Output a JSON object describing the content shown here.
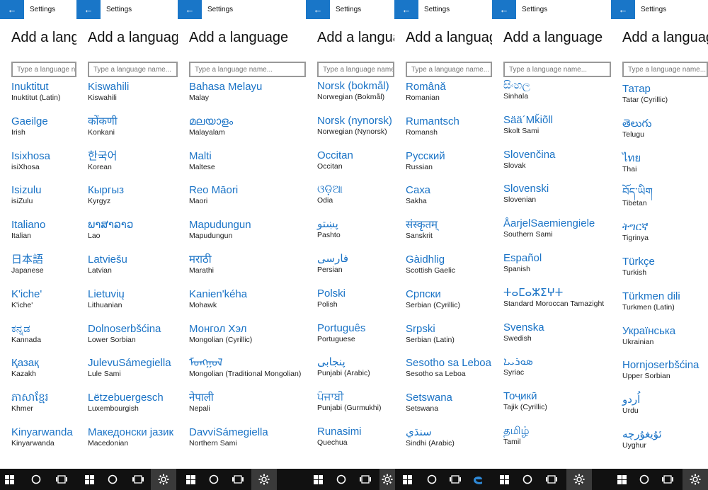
{
  "window": {
    "title": "Settings",
    "back": "←"
  },
  "page": {
    "title": "Add a language",
    "search_placeholder": "Type a language name..."
  },
  "columns": [
    {
      "languages": [
        {
          "native": "Inuktitut",
          "english": "Inuktitut (Latin)"
        },
        {
          "native": "Gaeilge",
          "english": "Irish"
        },
        {
          "native": "Isixhosa",
          "english": "isiXhosa"
        },
        {
          "native": "Isizulu",
          "english": "isiZulu"
        },
        {
          "native": "Italiano",
          "english": "Italian"
        },
        {
          "native": "日本語",
          "english": "Japanese"
        },
        {
          "native": "K'iche'",
          "english": "K'iche'"
        },
        {
          "native": "ಕನ್ನಡ",
          "english": "Kannada"
        },
        {
          "native": "Қазақ",
          "english": "Kazakh"
        },
        {
          "native": "ភាសាខ្មែរ",
          "english": "Khmer"
        },
        {
          "native": "Kinyarwanda",
          "english": "Kinyarwanda"
        }
      ]
    },
    {
      "languages": [
        {
          "native": "Kiswahili",
          "english": "Kiswahili"
        },
        {
          "native": "कोंकणी",
          "english": "Konkani"
        },
        {
          "native": "한국어",
          "english": "Korean"
        },
        {
          "native": "Кыргыз",
          "english": "Kyrgyz"
        },
        {
          "native": "ພາສາລາວ",
          "english": "Lao"
        },
        {
          "native": "Latviešu",
          "english": "Latvian"
        },
        {
          "native": "Lietuvių",
          "english": "Lithuanian"
        },
        {
          "native": "Dolnoserbšćina",
          "english": "Lower Sorbian"
        },
        {
          "native": "JulevuSámegiella",
          "english": "Lule Sami"
        },
        {
          "native": "Lëtzebuergesch",
          "english": "Luxembourgish"
        },
        {
          "native": "Македонски јазик",
          "english": "Macedonian"
        }
      ]
    },
    {
      "languages": [
        {
          "native": "Bahasa Melayu",
          "english": "Malay"
        },
        {
          "native": "മലയാളം",
          "english": "Malayalam"
        },
        {
          "native": "Malti",
          "english": "Maltese"
        },
        {
          "native": "Reo Māori",
          "english": "Maori"
        },
        {
          "native": "Mapudungun",
          "english": "Mapudungun"
        },
        {
          "native": "मराठी",
          "english": "Marathi"
        },
        {
          "native": "Kanien'kéha",
          "english": "Mohawk"
        },
        {
          "native": "Монгол Хэл",
          "english": "Mongolian (Cyrillic)"
        },
        {
          "native": "ᠮᠣᠩᠭᠣᠯ",
          "english": "Mongolian (Traditional Mongolian)"
        },
        {
          "native": "नेपाली",
          "english": "Nepali"
        },
        {
          "native": "DavviSámegiella",
          "english": "Northern Sami"
        }
      ]
    },
    {
      "languages": [
        {
          "native": "Norsk (bokmål)",
          "english": "Norwegian (Bokmål)"
        },
        {
          "native": "Norsk (nynorsk)",
          "english": "Norwegian (Nynorsk)"
        },
        {
          "native": "Occitan",
          "english": "Occitan"
        },
        {
          "native": "ଓଡ଼ିଆ",
          "english": "Odia"
        },
        {
          "native": "پښتو",
          "english": "Pashto"
        },
        {
          "native": "فارسی",
          "english": "Persian"
        },
        {
          "native": "Polski",
          "english": "Polish"
        },
        {
          "native": "Português",
          "english": "Portuguese"
        },
        {
          "native": "پنجابی",
          "english": "Punjabi (Arabic)"
        },
        {
          "native": "ਪੰਜਾਬੀ",
          "english": "Punjabi (Gurmukhi)"
        },
        {
          "native": "Runasimi",
          "english": "Quechua"
        }
      ]
    },
    {
      "languages": [
        {
          "native": "Română",
          "english": "Romanian"
        },
        {
          "native": "Rumantsch",
          "english": "Romansh"
        },
        {
          "native": "Русский",
          "english": "Russian"
        },
        {
          "native": "Саха",
          "english": "Sakha"
        },
        {
          "native": "संस्कृतम्",
          "english": "Sanskrit"
        },
        {
          "native": "Gàidhlig",
          "english": "Scottish Gaelic"
        },
        {
          "native": "Српски",
          "english": "Serbian (Cyrillic)"
        },
        {
          "native": "Srpski",
          "english": "Serbian (Latin)"
        },
        {
          "native": "Sesotho sa Leboa",
          "english": "Sesotho sa Leboa"
        },
        {
          "native": "Setswana",
          "english": "Setswana"
        },
        {
          "native": "سنڌي",
          "english": "Sindhi (Arabic)"
        }
      ]
    },
    {
      "languages": [
        {
          "native": "සිංහල",
          "english": "Sinhala"
        },
        {
          "native": "Sää´Mǩiõll",
          "english": "Skolt Sami"
        },
        {
          "native": "Slovenčina",
          "english": "Slovak"
        },
        {
          "native": "Slovenski",
          "english": "Slovenian"
        },
        {
          "native": "ÅarjelSaemiengiele",
          "english": "Southern Sami"
        },
        {
          "native": "Español",
          "english": "Spanish"
        },
        {
          "native": "ⵜⴰⵎⴰⵣⵉⵖⵜ",
          "english": "Standard Moroccan Tamazight"
        },
        {
          "native": "Svenska",
          "english": "Swedish"
        },
        {
          "native": "ܣܘܪܝܝܐ",
          "english": "Syriac"
        },
        {
          "native": "Тоҷикӣ",
          "english": "Tajik (Cyrillic)"
        },
        {
          "native": "தமிழ்",
          "english": "Tamil"
        }
      ]
    },
    {
      "languages": [
        {
          "native": "Татар",
          "english": "Tatar (Cyrillic)"
        },
        {
          "native": "తెలుగు",
          "english": "Telugu"
        },
        {
          "native": "ไทย",
          "english": "Thai"
        },
        {
          "native": "བོད་ཡིག",
          "english": "Tibetan"
        },
        {
          "native": "ትግርኛ",
          "english": "Tigrinya"
        },
        {
          "native": "Türkçe",
          "english": "Turkish"
        },
        {
          "native": "Türkmen dili",
          "english": "Turkmen (Latin)"
        },
        {
          "native": "Українська",
          "english": "Ukrainian"
        },
        {
          "native": "Hornjoserbšćina",
          "english": "Upper Sorbian"
        },
        {
          "native": "اُردو",
          "english": "Urdu"
        },
        {
          "native": "ئۇيغۇرچە",
          "english": "Uyghur"
        }
      ]
    }
  ],
  "taskbar": {
    "start_icon": "windows-start-icon",
    "search_icon": "cortana-circle-icon",
    "taskview_icon": "task-view-icon",
    "settings_icon": "gear-icon",
    "edge_icon": "edge-browser-icon"
  },
  "colors": {
    "accent": "#1976c8",
    "link": "#1a73c6",
    "taskbar": "#111111"
  }
}
